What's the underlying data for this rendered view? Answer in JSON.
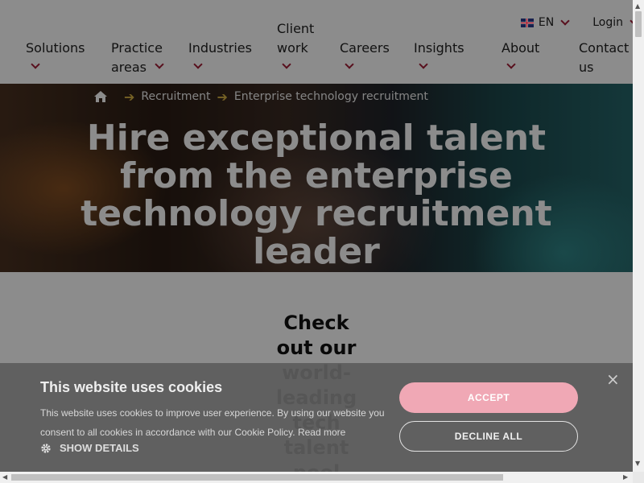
{
  "topbar": {
    "language": "EN",
    "login": "Login"
  },
  "nav": {
    "items": [
      {
        "label": "Solutions"
      },
      {
        "label": "Practice areas"
      },
      {
        "label": "Industries"
      },
      {
        "label": "Client work"
      },
      {
        "label": "Careers"
      },
      {
        "label": "Insights"
      },
      {
        "label": "About"
      },
      {
        "label": "Contact us"
      }
    ]
  },
  "breadcrumb": {
    "items": [
      "Recruitment",
      "Enterprise technology recruitment"
    ]
  },
  "hero": {
    "title": "Hire exceptional talent from the enterprise technology recruitment leader"
  },
  "content": {
    "heading": "Check out our world-leading tech talent pool"
  },
  "cookie": {
    "title": "This website uses cookies",
    "text": "This website uses cookies to improve user experience. By using our website you consent to all cookies in accordance with our Cookie Policy.",
    "read_more": "Read more",
    "show_details": "SHOW DETAILS",
    "accept": "ACCEPT",
    "decline": "DECLINE ALL",
    "close": "×"
  },
  "colors": {
    "accent": "#a01d36",
    "breadcrumb_arrow": "#d7b244",
    "accept_button": "#f0a8b5"
  }
}
